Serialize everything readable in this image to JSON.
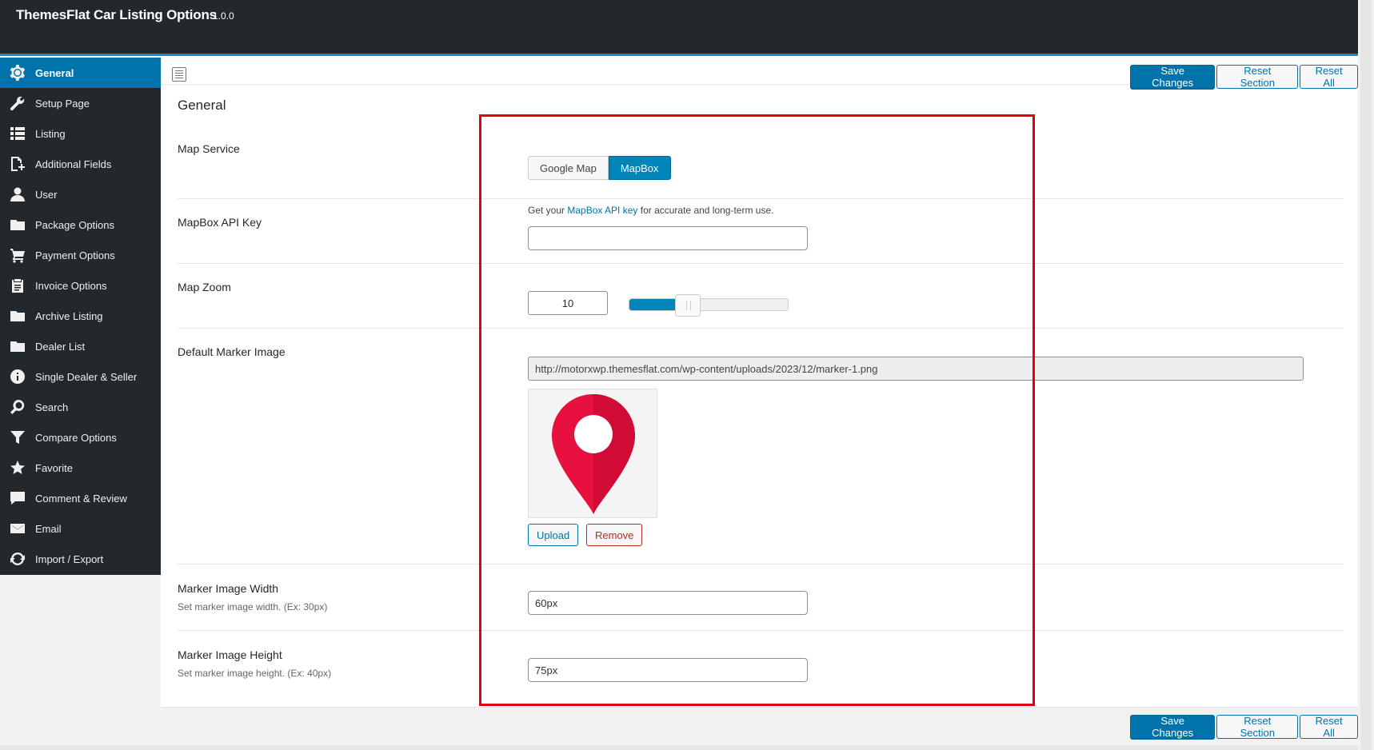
{
  "header": {
    "title": "ThemesFlat Car Listing Options",
    "version": "1.0.0"
  },
  "sidebar": {
    "items": [
      {
        "label": "General",
        "icon": "gear-icon",
        "active": true
      },
      {
        "label": "Setup Page",
        "icon": "wrench-icon"
      },
      {
        "label": "Listing",
        "icon": "list-icon"
      },
      {
        "label": "Additional Fields",
        "icon": "add-file-icon"
      },
      {
        "label": "User",
        "icon": "user-icon"
      },
      {
        "label": "Package Options",
        "icon": "folder-icon"
      },
      {
        "label": "Payment Options",
        "icon": "cart-icon"
      },
      {
        "label": "Invoice Options",
        "icon": "clipboard-icon"
      },
      {
        "label": "Archive Listing",
        "icon": "folder-icon"
      },
      {
        "label": "Dealer List",
        "icon": "folder-icon"
      },
      {
        "label": "Single Dealer & Seller",
        "icon": "info-icon"
      },
      {
        "label": "Search",
        "icon": "search-icon"
      },
      {
        "label": "Compare Options",
        "icon": "filter-icon"
      },
      {
        "label": "Favorite",
        "icon": "star-icon"
      },
      {
        "label": "Comment & Review",
        "icon": "comment-icon"
      },
      {
        "label": "Email",
        "icon": "email-icon"
      },
      {
        "label": "Import / Export",
        "icon": "refresh-icon"
      }
    ]
  },
  "toolbar": {
    "save_label": "Save Changes",
    "reset_section_label": "Reset Section",
    "reset_all_label": "Reset All"
  },
  "section": {
    "title": "General"
  },
  "fields": {
    "map_service": {
      "label": "Map Service",
      "options": [
        "Google Map",
        "MapBox"
      ],
      "selected": "MapBox"
    },
    "mapbox_api_key": {
      "label": "MapBox API Key",
      "help_prefix": "Get your ",
      "help_link": "MapBox API key",
      "help_suffix": " for accurate and long-term use.",
      "value": ""
    },
    "map_zoom": {
      "label": "Map Zoom",
      "value": "10",
      "slider_fraction": 0.37
    },
    "default_marker_image": {
      "label": "Default Marker Image",
      "url": "http://motorxwp.themesflat.com/wp-content/uploads/2023/12/marker-1.png",
      "upload_label": "Upload",
      "remove_label": "Remove"
    },
    "marker_width": {
      "label": "Marker Image Width",
      "desc": "Set marker image width. (Ex: 30px)",
      "value": "60px"
    },
    "marker_height": {
      "label": "Marker Image Height",
      "desc": "Set marker image height. (Ex: 40px)",
      "value": "75px"
    }
  },
  "colors": {
    "accent": "#0073aa",
    "highlight": "#e3000f",
    "marker": "#e8103c",
    "sidebar_bg": "#23282d"
  }
}
